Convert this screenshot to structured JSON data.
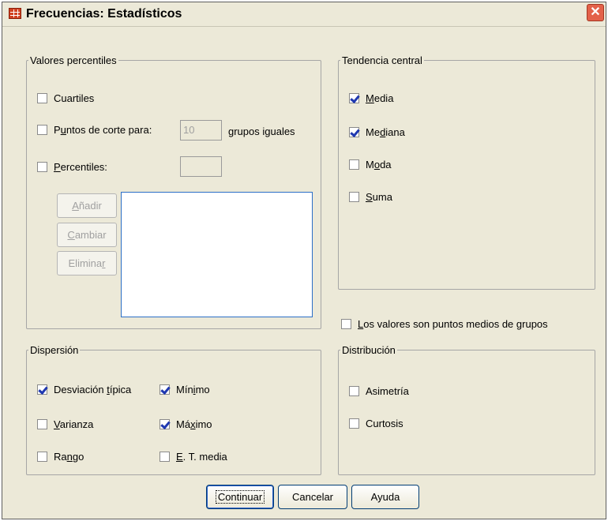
{
  "window": {
    "title": "Frecuencias: Estadísticos",
    "app_icon": "table-icon",
    "close_symbol": "✕"
  },
  "percentile_values": {
    "legend": "Valores percentiles",
    "quartiles": {
      "label": "Cuartiles",
      "checked": false
    },
    "cut_points": {
      "label_pre": "P",
      "label_u": "u",
      "label_post": "ntos de corte para:",
      "value": "10",
      "suffix": "grupos iguales",
      "checked": false
    },
    "percentiles": {
      "label_u": "P",
      "label_post": "ercentiles:",
      "value": "",
      "checked": false
    },
    "add_button": {
      "u": "A",
      "rest": "ñadir"
    },
    "change_button": {
      "u": "C",
      "rest": "ambiar"
    },
    "remove_button": {
      "pre": "Elimina",
      "u": "r"
    }
  },
  "central_tendency": {
    "legend": "Tendencia central",
    "mean": {
      "pre": "",
      "u": "M",
      "post": "edia",
      "checked": true
    },
    "median": {
      "pre": "Me",
      "u": "d",
      "post": "iana",
      "checked": true
    },
    "mode": {
      "pre": "M",
      "u": "o",
      "post": "da",
      "checked": false
    },
    "sum": {
      "pre": "",
      "u": "S",
      "post": "uma",
      "checked": false
    }
  },
  "midpoints": {
    "pre": "",
    "u": "L",
    "post": "os valores son puntos medios de grupos",
    "checked": false
  },
  "dispersion": {
    "legend": "Dispersión",
    "std_dev": {
      "pre": "Desviación ",
      "u": "t",
      "post": "ípica",
      "checked": true
    },
    "variance": {
      "pre": "",
      "u": "V",
      "post": "arianza",
      "checked": false
    },
    "range": {
      "pre": "Ra",
      "u": "n",
      "post": "go",
      "checked": false
    },
    "minimum": {
      "pre": "Mín",
      "u": "i",
      "post": "mo",
      "checked": true
    },
    "maximum": {
      "pre": "Má",
      "u": "x",
      "post": "imo",
      "checked": true
    },
    "se_mean": {
      "pre": "",
      "u": "E",
      "post": ". T. media",
      "checked": false
    }
  },
  "distribution": {
    "legend": "Distribución",
    "skewness": {
      "label": "Asimetría",
      "checked": false
    },
    "kurtosis": {
      "label": "Curtosis",
      "checked": false
    }
  },
  "buttons": {
    "continue": "Continuar",
    "cancel": "Cancelar",
    "help": "Ayuda"
  },
  "colors": {
    "check": "#1f38b0",
    "dialog_bg": "#ece9d8",
    "close_button": "#e3614a",
    "listbox_border": "#2b6fc7"
  }
}
